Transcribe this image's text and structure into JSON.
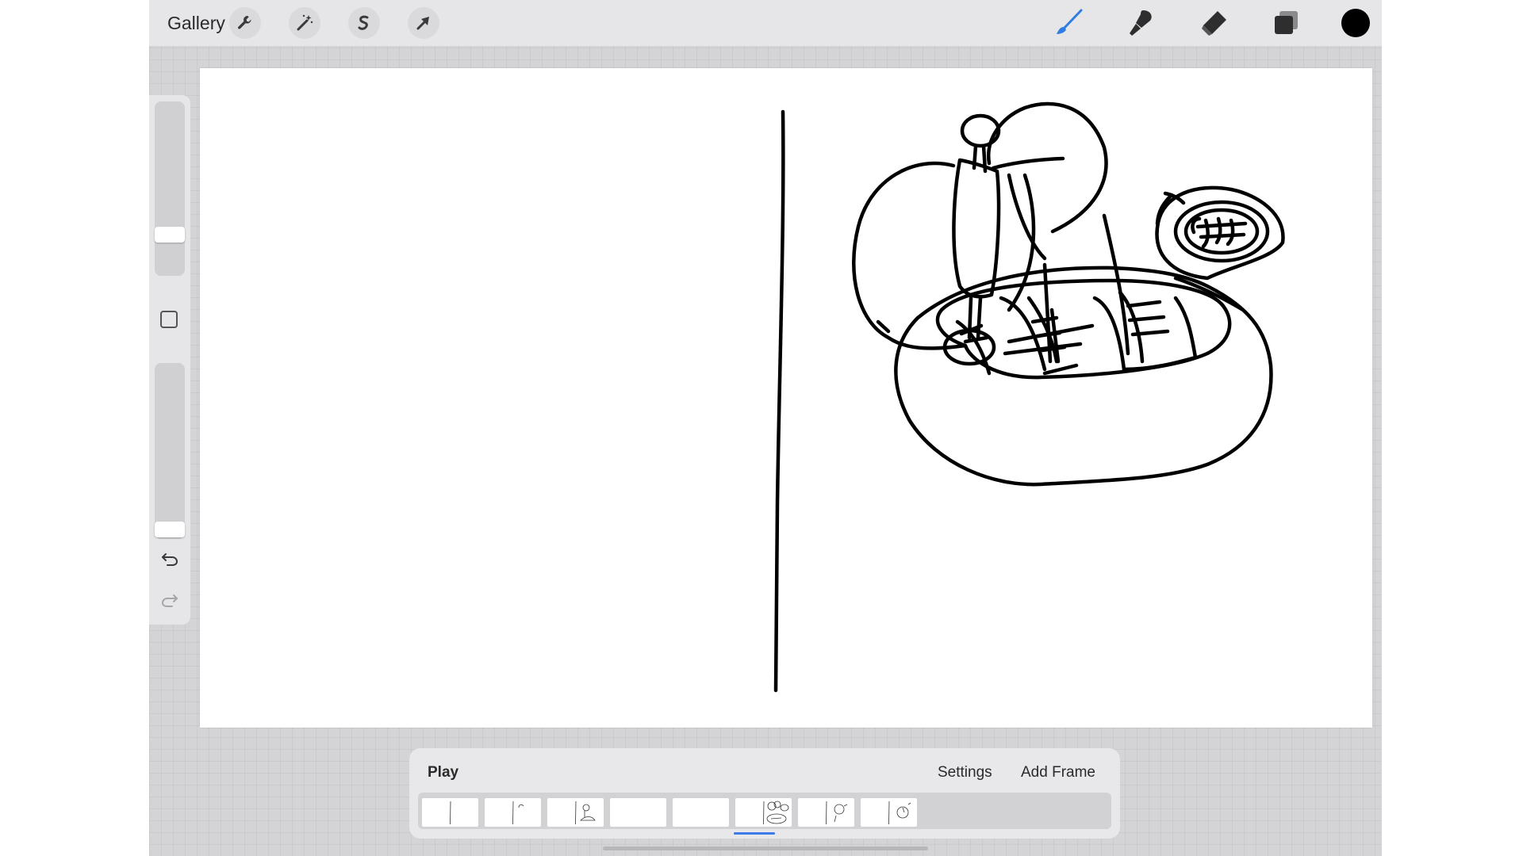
{
  "topbar": {
    "gallery_label": "Gallery",
    "left_tools": [
      {
        "icon": "wrench-icon",
        "name": "actions-button"
      },
      {
        "icon": "magic-wand-icon",
        "name": "adjustments-button"
      },
      {
        "icon": "selection-icon",
        "name": "selection-button"
      },
      {
        "icon": "arrow-cursor-icon",
        "name": "transform-button"
      }
    ],
    "right_tools": [
      {
        "icon": "brush-icon",
        "name": "brush-button",
        "active": true,
        "color": "#2f7de1"
      },
      {
        "icon": "smudge-icon",
        "name": "smudge-button",
        "active": false
      },
      {
        "icon": "eraser-icon",
        "name": "eraser-button",
        "active": false
      },
      {
        "icon": "layers-icon",
        "name": "layers-button",
        "active": false
      }
    ],
    "current_color": "#000000"
  },
  "sidebar": {
    "brush_size_level": 0.3,
    "opacity_level": 0.0,
    "undo_icon": "undo-icon",
    "redo_icon": "redo-icon"
  },
  "timeline": {
    "play_label": "Play",
    "settings_label": "Settings",
    "add_frame_label": "Add Frame",
    "frame_count": 8,
    "selected_frame_index": 5
  },
  "colors": {
    "accent": "#3d7be6",
    "ink": "#000000",
    "ui_background": "#d4d4d6",
    "toolbar": "#e6e6e8"
  }
}
